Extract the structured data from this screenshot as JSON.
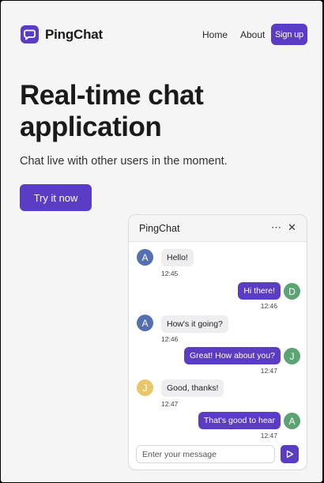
{
  "nav": {
    "brand": "PingChat",
    "links": [
      "Home",
      "About"
    ],
    "signup_label": "Sign up"
  },
  "hero": {
    "title": "Real-time chat application",
    "subtitle": "Chat live with other users in the moment.",
    "cta_label": "Try it now"
  },
  "chat": {
    "title": "PingChat",
    "more_icon": "⋯",
    "close_icon": "✕",
    "messages": [
      {
        "direction": "in",
        "avatar": "A",
        "avatar_color": "#5470b0",
        "text": "Hello!",
        "time": "12:45"
      },
      {
        "direction": "out",
        "avatar": "D",
        "avatar_color": "#5ba373",
        "text": "Hi there!",
        "time": "12:46"
      },
      {
        "direction": "in",
        "avatar": "A",
        "avatar_color": "#5470b0",
        "text": "How's it going?",
        "time": "12:46"
      },
      {
        "direction": "out",
        "avatar": "J",
        "avatar_color": "#5ba373",
        "text": "Great! How about you?",
        "time": "12:47"
      },
      {
        "direction": "in",
        "avatar": "J",
        "avatar_color": "#e8c76a",
        "text": "Good, thanks!",
        "time": "12:47"
      },
      {
        "direction": "out",
        "avatar": "A",
        "avatar_color": "#5ba373",
        "text": "That's good to hear",
        "time": "12:47"
      }
    ],
    "input_placeholder": "Enter your message",
    "send_icon": "send-icon"
  },
  "colors": {
    "accent": "#5b3cc4",
    "background": "#f5f5f6"
  }
}
